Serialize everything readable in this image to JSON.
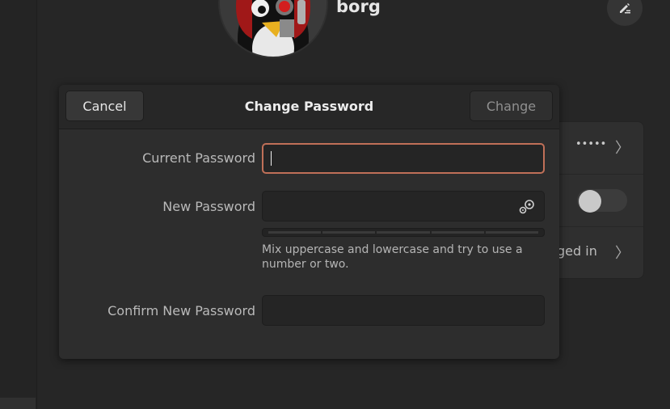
{
  "user": {
    "name": "borg"
  },
  "background_rows": {
    "password_mask": "•••••",
    "logged_in_partial": "ged in"
  },
  "dialog": {
    "title": "Change Password",
    "cancel_label": "Cancel",
    "change_label": "Change",
    "current_password": {
      "label": "Current Password",
      "value": ""
    },
    "new_password": {
      "label": "New Password",
      "value": "",
      "icon": "generate-password-icon",
      "strength_levels": 5,
      "strength_value": 0,
      "hint": "Mix uppercase and lowercase and try to use a number or two."
    },
    "confirm_password": {
      "label": "Confirm New Password",
      "value": ""
    }
  },
  "colors": {
    "focus_border": "#c07058",
    "dialog_bg": "#2d2d2d",
    "header_bg": "#272727"
  }
}
